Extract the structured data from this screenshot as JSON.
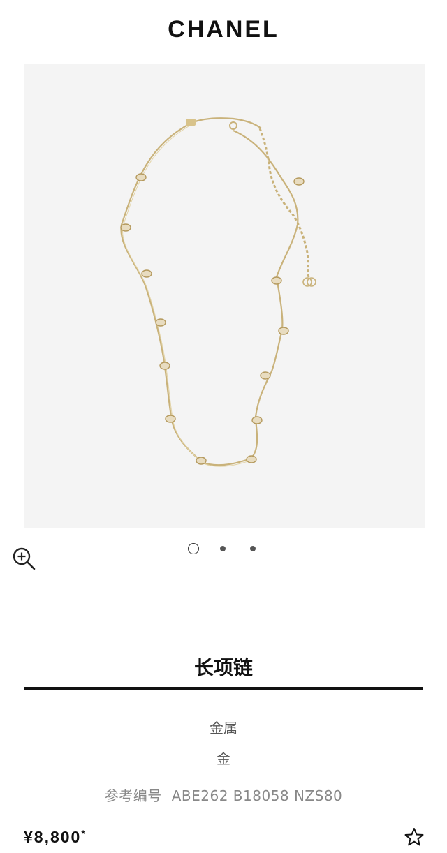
{
  "header": {
    "brand": "CHANEL"
  },
  "gallery": {
    "image_alt": "long necklace product photo",
    "zoom_icon": "zoom-in-icon",
    "slides": 3,
    "active_slide": 1
  },
  "product": {
    "title": "长项链",
    "material": "金属",
    "color": "金",
    "reference_label": "参考编号",
    "reference_code": "ABE262 B18058 NZS80",
    "price": "¥8,800",
    "price_mark": "*",
    "wishlist_icon": "star-icon"
  },
  "colors": {
    "chain_gold": "#c9b27a",
    "text_dark": "#111111",
    "text_grey": "#555555"
  }
}
